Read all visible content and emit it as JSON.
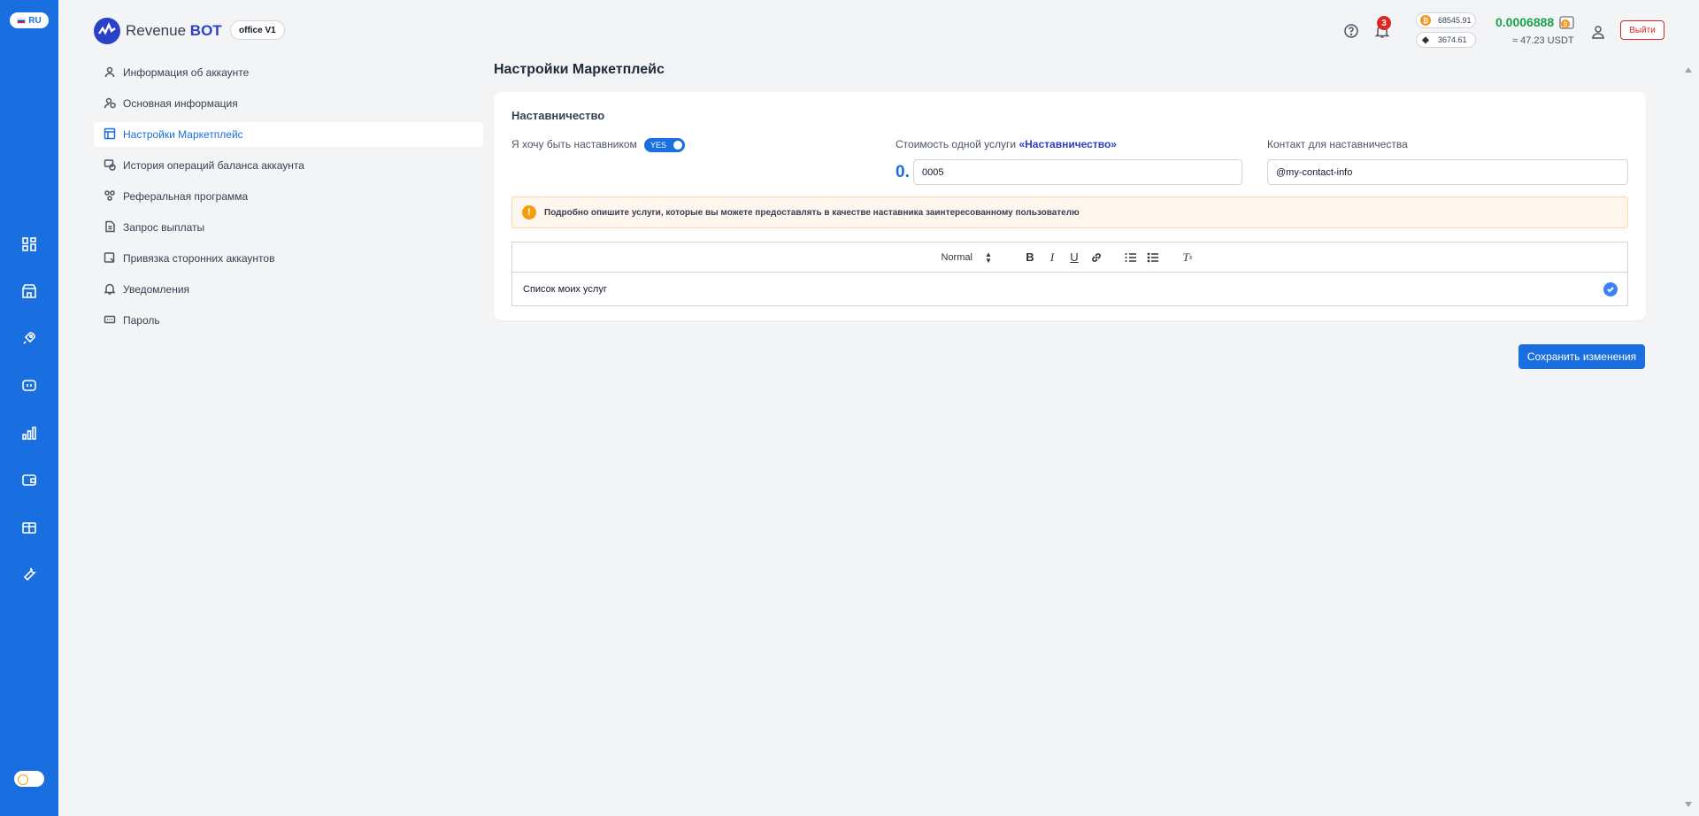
{
  "language": "RU",
  "logo": {
    "text_regular": "Revenue",
    "text_bold": "BOT"
  },
  "office_badge": "office V1",
  "header": {
    "notification_count": "3",
    "rates": {
      "btc": "68545.91",
      "eth": "3674.61"
    },
    "balance": "0.0006888",
    "balance_usdt": "≈ 47.23 USDT",
    "logout_label": "Выйти"
  },
  "rail_icons": [
    "dashboard-icon",
    "store-icon",
    "rocket-icon",
    "robot-icon",
    "chart-icon",
    "wallet-icon",
    "gift-icon",
    "wrench-icon"
  ],
  "settings_menu": [
    {
      "label": "Информация об аккаунте",
      "icon": "user-icon"
    },
    {
      "label": "Основная информация",
      "icon": "info-icon"
    },
    {
      "label": "Настройки Маркетплейс",
      "icon": "marketplace-icon",
      "active": true
    },
    {
      "label": "История операций баланса аккаунта",
      "icon": "history-icon"
    },
    {
      "label": "Реферальная программа",
      "icon": "referral-icon"
    },
    {
      "label": "Запрос выплаты",
      "icon": "payout-icon"
    },
    {
      "label": "Привязка сторонних аккаунтов",
      "icon": "link-accounts-icon"
    },
    {
      "label": "Уведомления",
      "icon": "bell-icon"
    },
    {
      "label": "Пароль",
      "icon": "password-icon"
    }
  ],
  "main": {
    "title": "Настройки Маркетплейс",
    "section_title": "Наставничество",
    "mentor_label": "Я хочу быть наставником",
    "toggle_label": "YES",
    "price_label": "Стоимость одной услуги",
    "price_label_highlight": "«Наставничество»",
    "price_prefix": "0.",
    "price_value": "0005",
    "contact_label": "Контакт для наставничества",
    "contact_value": "@my-contact-info",
    "notice": "Подробно опишите услуги, которые вы можете предоставлять в качестве наставника заинтересованному пользователю",
    "editor_format": "Normal",
    "editor_content": "Список моих услуг",
    "save_label": "Сохранить изменения"
  },
  "colors": {
    "accent": "#1a6fe0",
    "brand": "#2b40c8",
    "danger": "#dc2626",
    "balance": "#16a34a",
    "warning": "#f59e0b"
  }
}
